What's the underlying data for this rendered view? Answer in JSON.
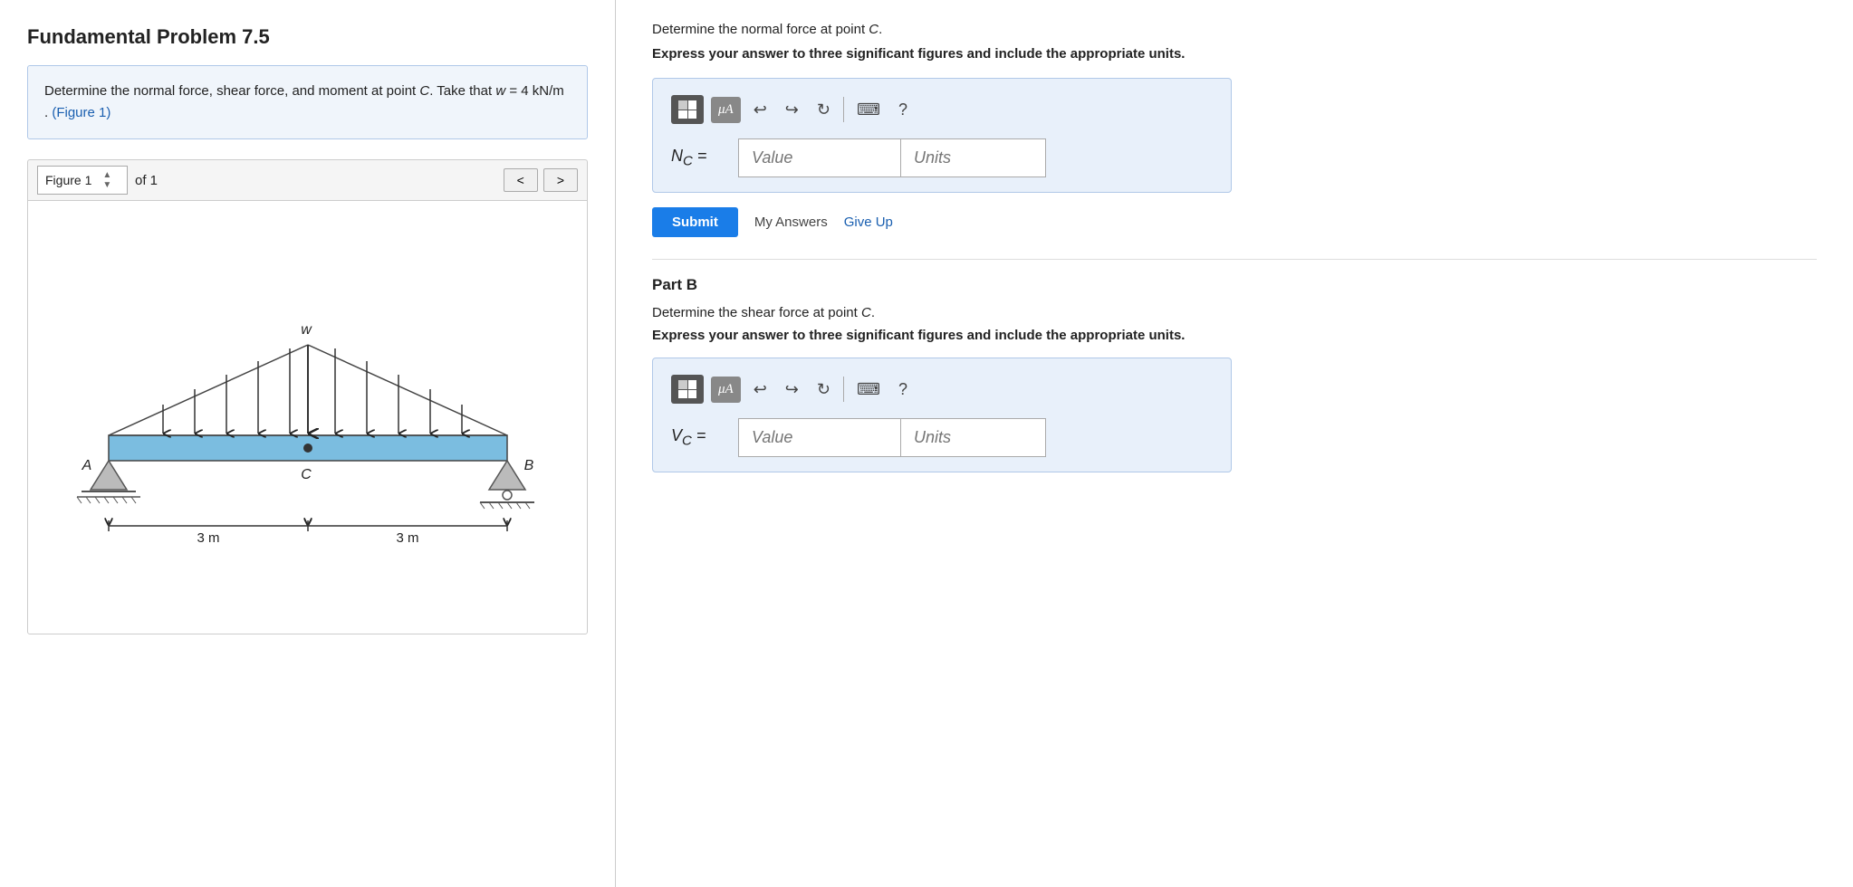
{
  "left": {
    "title": "Fundamental Problem 7.5",
    "description": "Determine the normal force, shear force, and moment at point C. Take that w = 4 kN/m .",
    "figure_link": "(Figure 1)",
    "figure_label": "Figure 1",
    "figure_of": "of 1",
    "nav_prev": "<",
    "nav_next": ">"
  },
  "right": {
    "part_a": {
      "instruction": "Determine the normal force at point C.",
      "bold_instruction": "Express your answer to three significant figures and include the appropriate units.",
      "answer_label": "N",
      "answer_subscript": "C",
      "answer_equals": "=",
      "value_placeholder": "Value",
      "units_placeholder": "Units",
      "submit_label": "Submit",
      "my_answers": "My Answers",
      "give_up": "Give Up"
    },
    "part_b": {
      "label": "Part B",
      "instruction": "Determine the shear force at point C.",
      "bold_instruction": "Express your answer to three significant figures and include the appropriate units.",
      "answer_label": "V",
      "answer_subscript": "C",
      "answer_equals": "=",
      "value_placeholder": "Value",
      "units_placeholder": "Units"
    },
    "toolbar": {
      "grid_title": "grid-icon",
      "mu_label": "μA",
      "undo": "↩",
      "redo": "↪",
      "refresh": "↻",
      "keyboard": "⌨",
      "help": "?"
    }
  }
}
